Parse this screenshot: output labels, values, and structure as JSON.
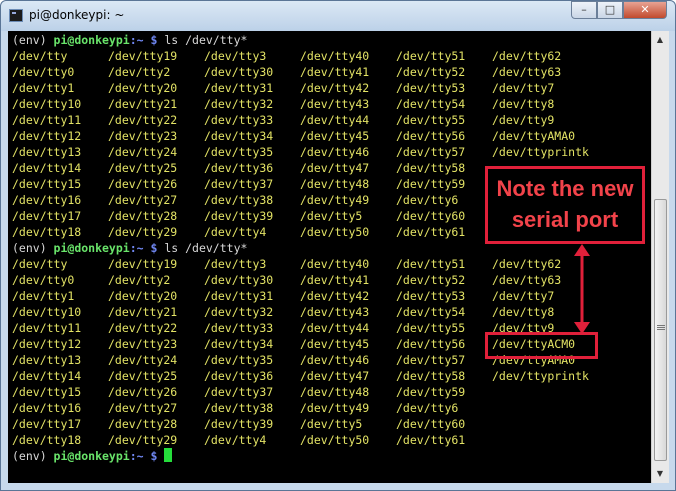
{
  "window": {
    "title": "pi@donkeypi: ~",
    "minimize_label": "–",
    "maximize_label": "□",
    "close_label": "✕"
  },
  "terminal": {
    "prompt": {
      "env": "(env) ",
      "user": "pi@donkeypi",
      "path": ":~ $",
      "cmd1": " ls /dev/tty*",
      "cmd2": " ls /dev/tty*",
      "cmd3": " "
    },
    "listing1": [
      [
        "/dev/tty",
        "/dev/tty19",
        "/dev/tty3",
        "/dev/tty40",
        "/dev/tty51",
        "/dev/tty62"
      ],
      [
        "/dev/tty0",
        "/dev/tty2",
        "/dev/tty30",
        "/dev/tty41",
        "/dev/tty52",
        "/dev/tty63"
      ],
      [
        "/dev/tty1",
        "/dev/tty20",
        "/dev/tty31",
        "/dev/tty42",
        "/dev/tty53",
        "/dev/tty7"
      ],
      [
        "/dev/tty10",
        "/dev/tty21",
        "/dev/tty32",
        "/dev/tty43",
        "/dev/tty54",
        "/dev/tty8"
      ],
      [
        "/dev/tty11",
        "/dev/tty22",
        "/dev/tty33",
        "/dev/tty44",
        "/dev/tty55",
        "/dev/tty9"
      ],
      [
        "/dev/tty12",
        "/dev/tty23",
        "/dev/tty34",
        "/dev/tty45",
        "/dev/tty56",
        "/dev/ttyAMA0"
      ],
      [
        "/dev/tty13",
        "/dev/tty24",
        "/dev/tty35",
        "/dev/tty46",
        "/dev/tty57",
        "/dev/ttyprintk"
      ],
      [
        "/dev/tty14",
        "/dev/tty25",
        "/dev/tty36",
        "/dev/tty47",
        "/dev/tty58",
        ""
      ],
      [
        "/dev/tty15",
        "/dev/tty26",
        "/dev/tty37",
        "/dev/tty48",
        "/dev/tty59",
        ""
      ],
      [
        "/dev/tty16",
        "/dev/tty27",
        "/dev/tty38",
        "/dev/tty49",
        "/dev/tty6",
        ""
      ],
      [
        "/dev/tty17",
        "/dev/tty28",
        "/dev/tty39",
        "/dev/tty5",
        "/dev/tty60",
        ""
      ],
      [
        "/dev/tty18",
        "/dev/tty29",
        "/dev/tty4",
        "/dev/tty50",
        "/dev/tty61",
        ""
      ]
    ],
    "listing2": [
      [
        "/dev/tty",
        "/dev/tty19",
        "/dev/tty3",
        "/dev/tty40",
        "/dev/tty51",
        "/dev/tty62"
      ],
      [
        "/dev/tty0",
        "/dev/tty2",
        "/dev/tty30",
        "/dev/tty41",
        "/dev/tty52",
        "/dev/tty63"
      ],
      [
        "/dev/tty1",
        "/dev/tty20",
        "/dev/tty31",
        "/dev/tty42",
        "/dev/tty53",
        "/dev/tty7"
      ],
      [
        "/dev/tty10",
        "/dev/tty21",
        "/dev/tty32",
        "/dev/tty43",
        "/dev/tty54",
        "/dev/tty8"
      ],
      [
        "/dev/tty11",
        "/dev/tty22",
        "/dev/tty33",
        "/dev/tty44",
        "/dev/tty55",
        "/dev/tty9"
      ],
      [
        "/dev/tty12",
        "/dev/tty23",
        "/dev/tty34",
        "/dev/tty45",
        "/dev/tty56",
        "/dev/ttyACM0"
      ],
      [
        "/dev/tty13",
        "/dev/tty24",
        "/dev/tty35",
        "/dev/tty46",
        "/dev/tty57",
        "/dev/ttyAMA0"
      ],
      [
        "/dev/tty14",
        "/dev/tty25",
        "/dev/tty36",
        "/dev/tty47",
        "/dev/tty58",
        "/dev/ttyprintk"
      ],
      [
        "/dev/tty15",
        "/dev/tty26",
        "/dev/tty37",
        "/dev/tty48",
        "/dev/tty59",
        ""
      ],
      [
        "/dev/tty16",
        "/dev/tty27",
        "/dev/tty38",
        "/dev/tty49",
        "/dev/tty6",
        ""
      ],
      [
        "/dev/tty17",
        "/dev/tty28",
        "/dev/tty39",
        "/dev/tty5",
        "/dev/tty60",
        ""
      ],
      [
        "/dev/tty18",
        "/dev/tty29",
        "/dev/tty4",
        "/dev/tty50",
        "/dev/tty61",
        ""
      ]
    ]
  },
  "annotation": {
    "note_line1": "Note the new",
    "note_line2": "serial port",
    "color": "#e0203a"
  },
  "icons": {
    "app": "terminal-icon",
    "scroll_up": "▲",
    "scroll_down": "▼"
  }
}
